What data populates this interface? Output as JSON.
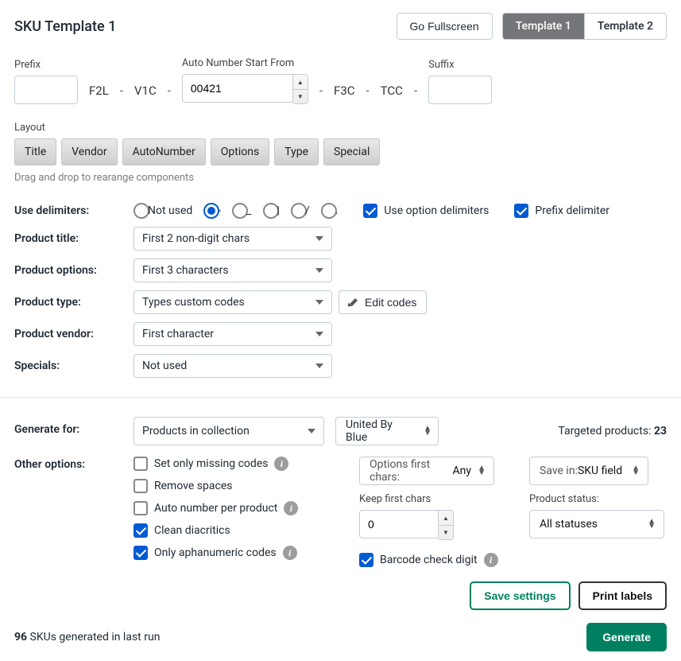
{
  "header": {
    "title": "SKU Template 1",
    "fullscreen": "Go Fullscreen",
    "tab1": "Template 1",
    "tab2": "Template 2"
  },
  "pattern": {
    "prefix_label": "Prefix",
    "prefix_value": "",
    "tok1": "F2L",
    "tok2": "V1C",
    "autonum_label": "Auto Number Start From",
    "autonum_value": "00421",
    "tok3": "F3C",
    "tok4": "TCC",
    "suffix_label": "Suffix",
    "suffix_value": ""
  },
  "layout": {
    "label": "Layout",
    "chips": [
      "Title",
      "Vendor",
      "AutoNumber",
      "Options",
      "Type",
      "Special"
    ],
    "hint": "Drag and drop to rearange components"
  },
  "delimiters": {
    "label": "Use delimiters:",
    "options": [
      "Not used",
      "-",
      "_",
      "|",
      "/",
      "."
    ],
    "selected": "-",
    "use_option_label": "Use option delimiters",
    "use_option_checked": true,
    "prefix_delim_label": "Prefix delimiter",
    "prefix_delim_checked": true
  },
  "mapping": {
    "title_label": "Product title:",
    "title_value": "First 2 non-digit chars",
    "options_label": "Product options:",
    "options_value": "First 3 characters",
    "type_label": "Product type:",
    "type_value": "Types custom codes",
    "edit_codes": "Edit codes",
    "vendor_label": "Product vendor:",
    "vendor_value": "First character",
    "specials_label": "Specials:",
    "specials_value": "Not used"
  },
  "generate": {
    "for_label": "Generate for:",
    "for_value": "Products in collection",
    "collection": "United By Blue",
    "target_prefix": "Targeted products: ",
    "target_count": "23"
  },
  "other": {
    "label": "Other options:",
    "set_missing": "Set only missing codes",
    "remove_spaces": "Remove spaces",
    "auto_per_product": "Auto number per product",
    "clean_diacritics": "Clean diacritics",
    "only_alnum": "Only aphanumeric codes",
    "options_first_chars_label": "Options first chars: ",
    "options_first_chars_value": "Any",
    "keep_first_label": "Keep first chars",
    "keep_first_value": "0",
    "barcode_check_label": "Barcode check digit",
    "save_in_label": "Save in: ",
    "save_in_value": "SKU field",
    "status_label": "Product status:",
    "status_value": "All statuses"
  },
  "actions": {
    "save": "Save settings",
    "print": "Print labels",
    "generate": "Generate"
  },
  "footer": {
    "last_run_count": "96",
    "last_run_suffix": " SKUs generated in last run"
  }
}
